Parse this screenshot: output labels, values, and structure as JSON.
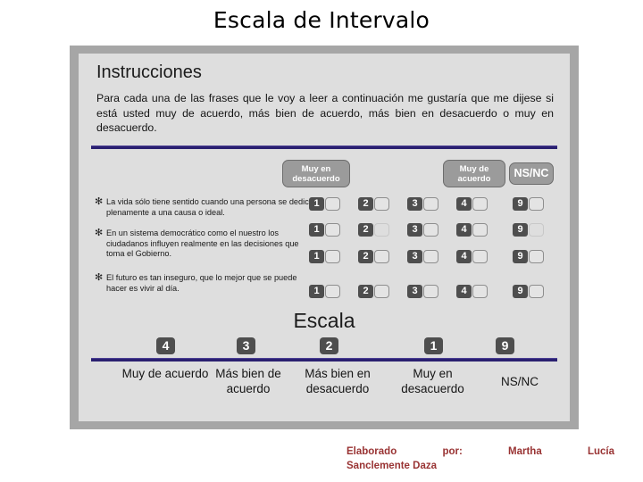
{
  "slide": {
    "title": "Escala de Intervalo"
  },
  "instructions": {
    "heading": "Instrucciones",
    "body": "Para cada una de las frases que le voy a leer a continuación me gustaría que me dijese si está usted muy de acuerdo, más bien de acuerdo, más bien en desacuerdo o muy en desacuerdo."
  },
  "anchors": [
    {
      "name": "muy-en-desacuerdo",
      "label": "Muy en desacuerdo"
    },
    {
      "name": "muy-de-acuerdo",
      "label": "Muy de acuerdo"
    },
    {
      "name": "ns-nc",
      "label": "NS/NC"
    }
  ],
  "statements": [
    {
      "bullet": "✻",
      "text": "La vida sólo tiene sentido cuando una persona se dedica plenamente a una causa o ideal."
    },
    {
      "bullet": "✻",
      "text": "En un sistema democrático como el nuestro los ciudadanos influyen realmente en las decisiones que toma el Gobierno."
    },
    {
      "bullet": "✻",
      "text": "El futuro es tan inseguro, que lo mejor que se puede hacer es vivir al día."
    }
  ],
  "option_numbers": [
    "1",
    "2",
    "3",
    "4",
    "9"
  ],
  "answer_rows": [
    {
      "row": 1,
      "options": [
        "1",
        "2",
        "3",
        "4",
        "9"
      ]
    },
    {
      "row": 2,
      "options": [
        "1",
        "2",
        "3",
        "4",
        "9"
      ]
    },
    {
      "row": 3,
      "options": [
        "1",
        "2",
        "3",
        "4",
        "9"
      ]
    },
    {
      "row": 4,
      "options": [
        "1",
        "2",
        "3",
        "4",
        "9"
      ]
    }
  ],
  "scale": {
    "heading": "Escala",
    "points": [
      {
        "number": "4",
        "label": "Muy de acuerdo"
      },
      {
        "number": "3",
        "label": "Más bien de acuerdo"
      },
      {
        "number": "2",
        "label": "Más bien en desacuerdo"
      },
      {
        "number": "1",
        "label": "Muy en desacuerdo"
      },
      {
        "number": "9",
        "label": "NS/NC"
      }
    ]
  },
  "footer": {
    "line1": "Elaborado por: Martha Lucía",
    "line2": "Sanclemente Daza"
  },
  "colors": {
    "frame_border": "#a6a6a6",
    "panel_background": "#dedede",
    "rule_navy": "#2a2070",
    "chip_dark": "#4e4e4e",
    "badge_gray": "#9b9b9b",
    "footer_red": "#993333"
  }
}
